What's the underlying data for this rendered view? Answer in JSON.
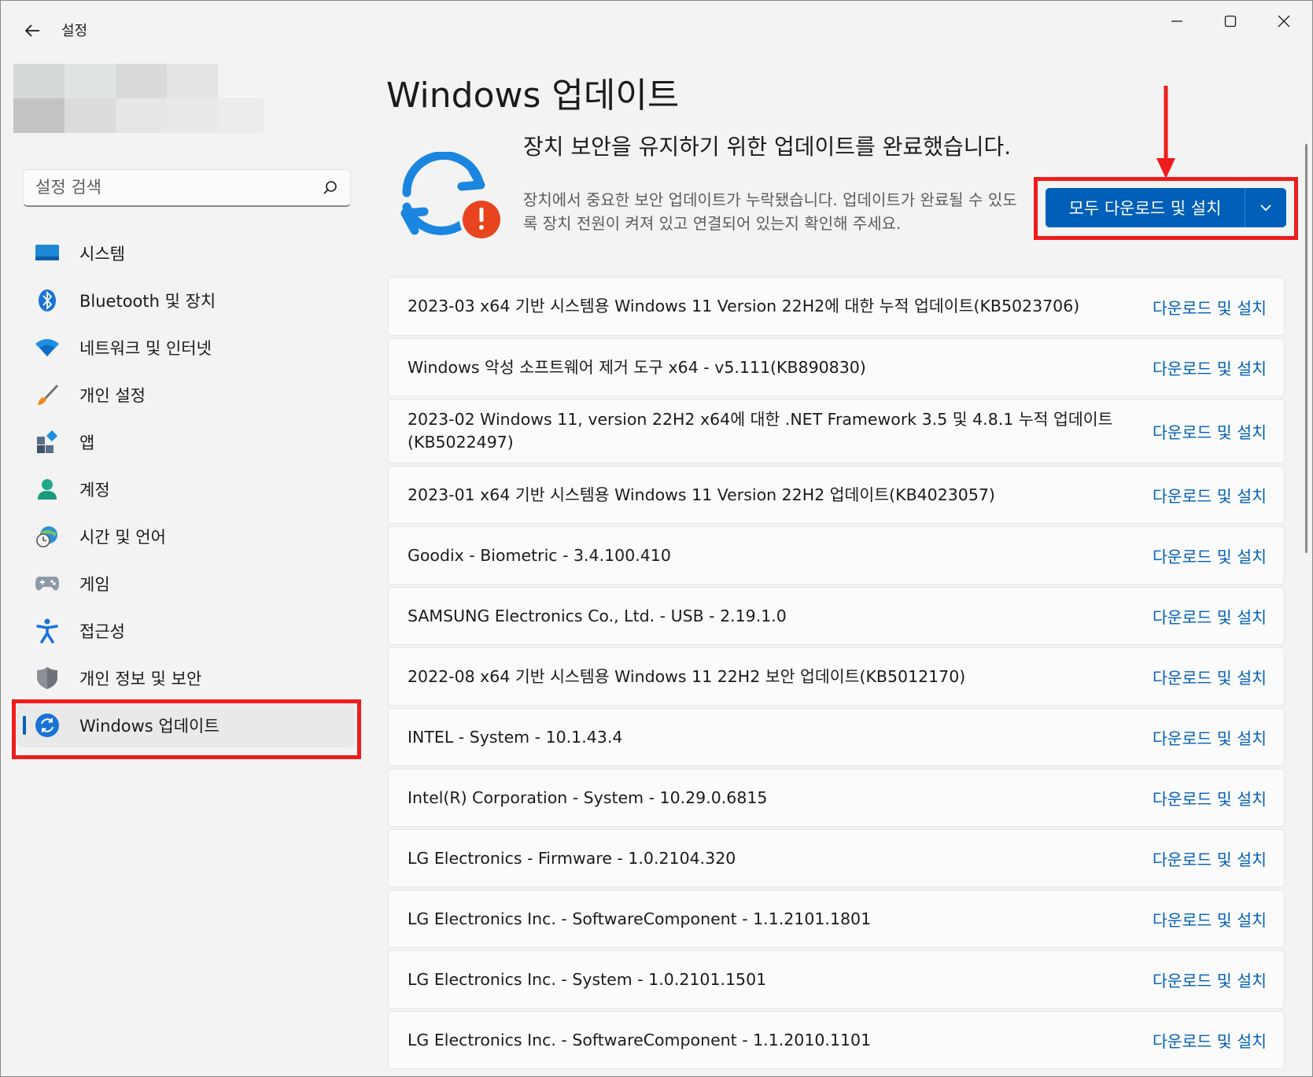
{
  "app": {
    "title": "설정"
  },
  "search": {
    "placeholder": "설정 검색"
  },
  "nav": {
    "items": [
      {
        "label": "시스템",
        "icon": "monitor-icon"
      },
      {
        "label": "Bluetooth 및 장치",
        "icon": "bluetooth-icon"
      },
      {
        "label": "네트워크 및 인터넷",
        "icon": "wifi-icon"
      },
      {
        "label": "개인 설정",
        "icon": "brush-icon"
      },
      {
        "label": "앱",
        "icon": "apps-icon"
      },
      {
        "label": "계정",
        "icon": "person-icon"
      },
      {
        "label": "시간 및 언어",
        "icon": "globe-clock-icon"
      },
      {
        "label": "게임",
        "icon": "gamepad-icon"
      },
      {
        "label": "접근성",
        "icon": "accessibility-icon"
      },
      {
        "label": "개인 정보 및 보안",
        "icon": "shield-icon"
      },
      {
        "label": "Windows 업데이트",
        "icon": "sync-icon",
        "active": true
      }
    ]
  },
  "main": {
    "title": "Windows 업데이트",
    "status_heading": "장치 보안을 유지하기 위한 업데이트를 완료했습니다.",
    "status_detail": "장치에서 중요한 보안 업데이트가 누락됐습니다. 업데이트가 완료될 수 있도록 장치 전원이 켜져 있고 연결되어 있는지 확인해 주세요.",
    "download_all_label": "모두 다운로드 및 설치"
  },
  "updates": [
    {
      "name": "2023-03 x64 기반 시스템용 Windows 11 Version 22H2에 대한 누적 업데이트(KB5023706)",
      "action": "다운로드 및 설치"
    },
    {
      "name": "Windows 악성 소프트웨어 제거 도구 x64 - v5.111(KB890830)",
      "action": "다운로드 및 설치"
    },
    {
      "name": "2023-02 Windows 11, version 22H2 x64에 대한 .NET Framework 3.5 및 4.8.1 누적 업데이트(KB5022497)",
      "action": "다운로드 및 설치"
    },
    {
      "name": "2023-01 x64 기반 시스템용 Windows 11 Version 22H2 업데이트(KB4023057)",
      "action": "다운로드 및 설치"
    },
    {
      "name": "Goodix - Biometric - 3.4.100.410",
      "action": "다운로드 및 설치"
    },
    {
      "name": "SAMSUNG Electronics Co., Ltd.  - USB - 2.19.1.0",
      "action": "다운로드 및 설치"
    },
    {
      "name": "2022-08 x64 기반 시스템용 Windows 11 22H2 보안 업데이트(KB5012170)",
      "action": "다운로드 및 설치"
    },
    {
      "name": "INTEL - System - 10.1.43.4",
      "action": "다운로드 및 설치"
    },
    {
      "name": "Intel(R) Corporation - System - 10.29.0.6815",
      "action": "다운로드 및 설치"
    },
    {
      "name": "LG Electronics - Firmware - 1.0.2104.320",
      "action": "다운로드 및 설치"
    },
    {
      "name": "LG Electronics Inc. - SoftwareComponent - 1.1.2101.1801",
      "action": "다운로드 및 설치"
    },
    {
      "name": "LG Electronics Inc. - System - 1.0.2101.1501",
      "action": "다운로드 및 설치"
    },
    {
      "name": "LG Electronics Inc. - SoftwareComponent - 1.1.2010.1101",
      "action": "다운로드 및 설치"
    }
  ],
  "colors": {
    "accent": "#005fb8",
    "highlight": "#ee1c1c",
    "warning": "#e8451e"
  }
}
